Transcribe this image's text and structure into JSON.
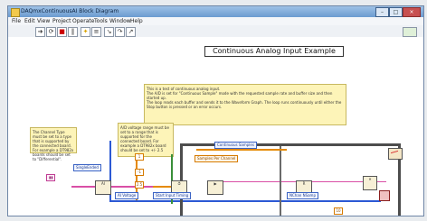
{
  "window": {
    "title": "DAQmxContinuousAI Block Diagram",
    "controls": [
      "–",
      "□",
      "×"
    ]
  },
  "menu": [
    "File",
    "Edit",
    "View",
    "Project",
    "Operate",
    "Tools",
    "Window",
    "Help"
  ],
  "toolbar": {
    "icons": [
      "run-arrow-icon",
      "run-continuous-icon",
      "abort-icon",
      "pause-icon",
      "highlight-icon",
      "retain-wire-icon",
      "step-into-icon",
      "step-over-icon",
      "step-out-icon"
    ]
  },
  "diagram": {
    "title": "Continuous Analog Input Example",
    "description": [
      "This is a test of continuous analog input.",
      "The A/D is set for \"Continuous Sample\" mode with the requested sample rate and buffer size and then started up.",
      "The loop reads each buffer and sends it to the Waveform Graph. The loop runs continuously until either the Stop button is pressed or an error occurs."
    ],
    "channel_note": "The Channel Type must be set to a type that is supported by the connected board. For example a DT982x boards should be set to \"Differential\".",
    "voltage_note": "A/D voltage range must be set to a range that is supported for the connected board. For example a DT982x board should be set to +/- 2.5",
    "labels": {
      "continuous_samples": "Continuous Samples",
      "samples_per_channel": "Samples Per Channel",
      "single_ended": "SingleEnded",
      "ai_volts": "AI Voltage",
      "start_input": "Start Input Timing",
      "nchan_nsamp": "NChan NSamp",
      "timeout": "10"
    }
  }
}
